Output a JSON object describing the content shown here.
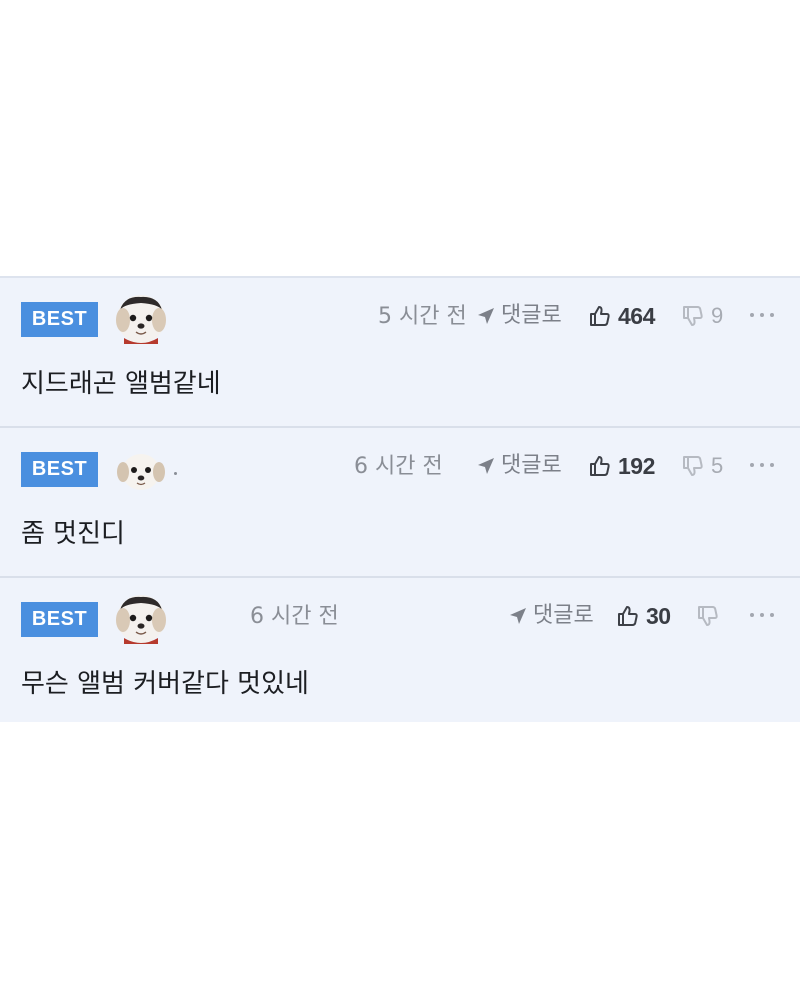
{
  "comments": [
    {
      "badge": "BEST",
      "time": "5 시간 전",
      "reply_label": "댓글로",
      "likes": "464",
      "dislikes": "9",
      "text": "지드래곤 앨범같네"
    },
    {
      "badge": "BEST",
      "time": "6 시간 전",
      "reply_label": "댓글로",
      "likes": "192",
      "dislikes": "5",
      "text": "좀 멋진디"
    },
    {
      "badge": "BEST",
      "time": "6 시간 전",
      "reply_label": "댓글로",
      "likes": "30",
      "dislikes": "",
      "text": "무슨 앨범 커버같다 멋있네"
    }
  ],
  "icons": {
    "reply": "reply-arrow-icon",
    "like": "thumbs-up-icon",
    "dislike": "thumbs-down-icon",
    "more": "more-dots-icon",
    "avatar": "puppy-avatar-icon"
  },
  "colors": {
    "badge": "#4a8fdf",
    "panel_bg": "#eff3fb",
    "divider": "#d9dfea"
  }
}
